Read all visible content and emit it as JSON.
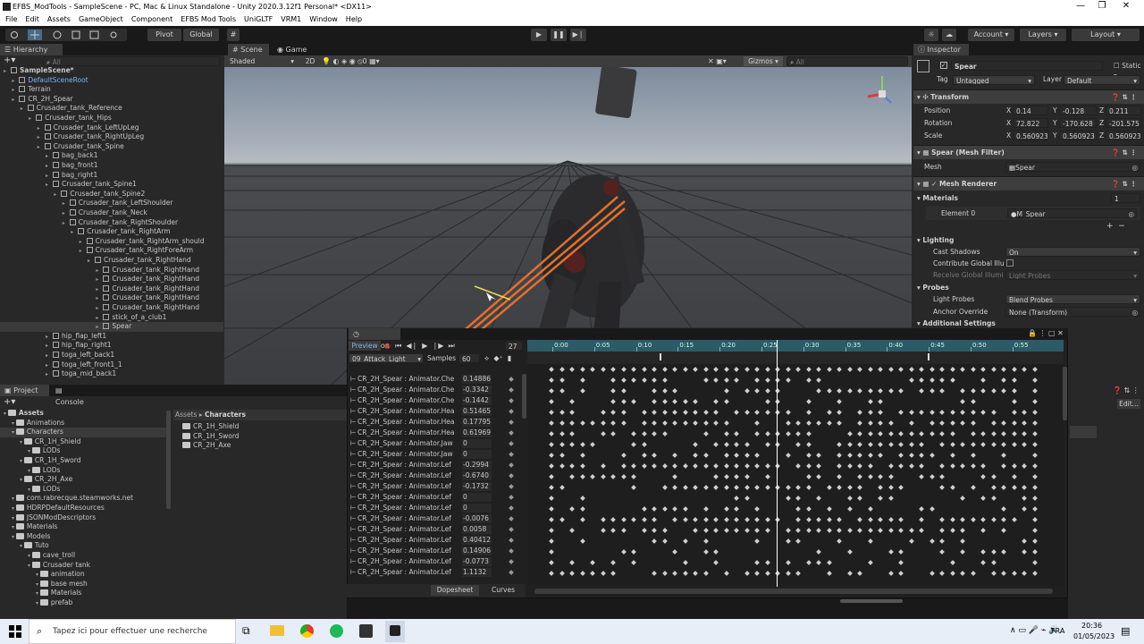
{
  "titlebar": {
    "title": "EFBS_ModTools - SampleScene - PC, Mac & Linux Standalone - Unity 2020.3.12f1 Personal* <DX11>",
    "minimize": "—",
    "maximize": "❐",
    "close": "✕"
  },
  "menu": [
    "File",
    "Edit",
    "Assets",
    "GameObject",
    "Component",
    "EFBS Mod Tools",
    "UniGLTF",
    "VRM1",
    "Window",
    "Help"
  ],
  "toolbar": {
    "pivot": "Pivot",
    "global": "Global",
    "account": "Account",
    "layers": "Layers",
    "layout": "Layout"
  },
  "hierarchy": {
    "tab": "Hierarchy",
    "search_placeholder": "All",
    "items": [
      {
        "label": "SampleScene*",
        "depth": 0
      },
      {
        "label": "DefaultSceneRoot",
        "depth": 1
      },
      {
        "label": "Terrain",
        "depth": 1
      },
      {
        "label": "CR_2H_Spear",
        "depth": 1
      },
      {
        "label": "Crusader_tank_Reference",
        "depth": 2
      },
      {
        "label": "Crusader_tank_Hips",
        "depth": 3
      },
      {
        "label": "Crusader_tank_LeftUpLeg",
        "depth": 4
      },
      {
        "label": "Crusader_tank_RightUpLeg",
        "depth": 4
      },
      {
        "label": "Crusader_tank_Spine",
        "depth": 4
      },
      {
        "label": "bag_back1",
        "depth": 5
      },
      {
        "label": "bag_front1",
        "depth": 5
      },
      {
        "label": "bag_right1",
        "depth": 5
      },
      {
        "label": "Crusader_tank_Spine1",
        "depth": 5
      },
      {
        "label": "Crusader_tank_Spine2",
        "depth": 6
      },
      {
        "label": "Crusader_tank_LeftShoulder",
        "depth": 7
      },
      {
        "label": "Crusader_tank_Neck",
        "depth": 7
      },
      {
        "label": "Crusader_tank_RightShoulder",
        "depth": 7
      },
      {
        "label": "Crusader_tank_RightArm",
        "depth": 8
      },
      {
        "label": "Crusader_tank_RightArm_should",
        "depth": 9
      },
      {
        "label": "Crusader_tank_RightForeArm",
        "depth": 9
      },
      {
        "label": "Crusader_tank_RightHand",
        "depth": 10
      },
      {
        "label": "Crusader_tank_RightHand",
        "depth": 11
      },
      {
        "label": "Crusader_tank_RightHand",
        "depth": 11
      },
      {
        "label": "Crusader_tank_RightHand",
        "depth": 11
      },
      {
        "label": "Crusader_tank_RightHand",
        "depth": 11
      },
      {
        "label": "Crusader_tank_RightHand",
        "depth": 11
      },
      {
        "label": "stick_of_a_club1",
        "depth": 11
      },
      {
        "label": "Spear",
        "depth": 11
      },
      {
        "label": "hip_flap_left1",
        "depth": 5
      },
      {
        "label": "hip_flap_right1",
        "depth": 5
      },
      {
        "label": "toga_left_back1",
        "depth": 5
      },
      {
        "label": "toga_left_front1_1",
        "depth": 5
      },
      {
        "label": "toga_mid_back1",
        "depth": 5
      }
    ]
  },
  "scene": {
    "tab_scene": "Scene",
    "tab_game": "Game",
    "shading": "Shaded",
    "mode_2d": "2D",
    "gizmos": "Gizmos",
    "search_placeholder": "All",
    "hidden_count": "0"
  },
  "inspector": {
    "tab": "Inspector",
    "object_name": "Spear",
    "static_label": "Static",
    "tag_label": "Tag",
    "tag_value": "Untagged",
    "layer_label": "Layer",
    "layer_value": "Default",
    "transform": {
      "title": "Transform",
      "position_label": "Position",
      "position": {
        "x": "0.14",
        "y": "-0.128",
        "z": "0.211"
      },
      "rotation_label": "Rotation",
      "rotation": {
        "x": "72.822",
        "y": "-170.628",
        "z": "-201.575"
      },
      "scale_label": "Scale",
      "scale": {
        "x": "0.560923",
        "y": "0.560923",
        "z": "0.560923"
      }
    },
    "mesh_filter": {
      "title": "Spear (Mesh Filter)",
      "mesh_label": "Mesh",
      "mesh_value": "Spear"
    },
    "mesh_renderer": {
      "title": "Mesh Renderer",
      "materials_label": "Materials",
      "materials_count": "1",
      "element0_label": "Element 0",
      "element0_value": "M_Spear",
      "lighting": "Lighting",
      "cast_shadows_label": "Cast Shadows",
      "cast_shadows_value": "On",
      "contribute_gi_label": "Contribute Global Illu",
      "receive_gi_label": "Receive Global Illumi",
      "receive_gi_value": "Light Probes",
      "probes": "Probes",
      "light_probes_label": "Light Probes",
      "light_probes_value": "Blend Probes",
      "anchor_label": "Anchor Override",
      "anchor_value": "None (Transform)",
      "additional": "Additional Settings"
    }
  },
  "project": {
    "tab_project": "Project",
    "tab_console": "Console",
    "tree": [
      {
        "label": "Assets",
        "depth": 0
      },
      {
        "label": "Animations",
        "depth": 1
      },
      {
        "label": "Characters",
        "depth": 1
      },
      {
        "label": "CR_1H_Shield",
        "depth": 2
      },
      {
        "label": "LODs",
        "depth": 3
      },
      {
        "label": "CR_1H_Sword",
        "depth": 2
      },
      {
        "label": "LODs",
        "depth": 3
      },
      {
        "label": "CR_2H_Axe",
        "depth": 2
      },
      {
        "label": "LODs",
        "depth": 3
      },
      {
        "label": "com.rabrecque.steamworks.net",
        "depth": 1
      },
      {
        "label": "HDRPDefaultResources",
        "depth": 1
      },
      {
        "label": "JSONModDescriptors",
        "depth": 1
      },
      {
        "label": "Materials",
        "depth": 1
      },
      {
        "label": "Models",
        "depth": 1
      },
      {
        "label": "Tuto",
        "depth": 2
      },
      {
        "label": "cave_troll",
        "depth": 3
      },
      {
        "label": "Crusader tank",
        "depth": 3
      },
      {
        "label": "animation",
        "depth": 4
      },
      {
        "label": "base mesh",
        "depth": 4
      },
      {
        "label": "Materials",
        "depth": 4
      },
      {
        "label": "prefab",
        "depth": 4
      }
    ],
    "breadcrumb_root": "Assets",
    "breadcrumb_sep": "▸",
    "breadcrumb_current": "Characters",
    "files": [
      "CR_1H_Shield",
      "CR_1H_Sword",
      "CR_2H_Axe"
    ]
  },
  "animation": {
    "tab": "Animation",
    "preview": "Preview",
    "frame": "27",
    "clip": "09_Attack_Light",
    "samples_label": "Samples",
    "samples_value": "60",
    "time_labels": [
      "0:00",
      "0:05",
      "0:10",
      "0:15",
      "0:20",
      "0:25",
      "0:30",
      "0:35",
      "0:40",
      "0:45",
      "0:50",
      "0:55"
    ],
    "properties": [
      {
        "name": "CR_2H_Spear : Animator.Che",
        "value": "0.14886"
      },
      {
        "name": "CR_2H_Spear : Animator.Che",
        "value": "-0.3342"
      },
      {
        "name": "CR_2H_Spear : Animator.Che",
        "value": "-0.1442"
      },
      {
        "name": "CR_2H_Spear : Animator.Hea",
        "value": "0.51465"
      },
      {
        "name": "CR_2H_Spear : Animator.Hea",
        "value": "0.17795"
      },
      {
        "name": "CR_2H_Spear : Animator.Hea",
        "value": "0.61969"
      },
      {
        "name": "CR_2H_Spear : Animator.Jaw",
        "value": "0"
      },
      {
        "name": "CR_2H_Spear : Animator.Jaw",
        "value": "0"
      },
      {
        "name": "CR_2H_Spear : Animator.Lef",
        "value": "-0.2994"
      },
      {
        "name": "CR_2H_Spear : Animator.Lef",
        "value": "-0.6740"
      },
      {
        "name": "CR_2H_Spear : Animator.Lef",
        "value": "-0.1732"
      },
      {
        "name": "CR_2H_Spear : Animator.Lef",
        "value": "0"
      },
      {
        "name": "CR_2H_Spear : Animator.Lef",
        "value": "0"
      },
      {
        "name": "CR_2H_Spear : Animator.Lef",
        "value": "-0.0076"
      },
      {
        "name": "CR_2H_Spear : Animator.Lef",
        "value": "0.0058"
      },
      {
        "name": "CR_2H_Spear : Animator.Lef",
        "value": "0.40412"
      },
      {
        "name": "CR_2H_Spear : Animator.Lef",
        "value": "0.14906"
      },
      {
        "name": "CR_2H_Spear : Animator.Lef",
        "value": "-0.0773"
      },
      {
        "name": "CR_2H_Spear : Animator.Lef",
        "value": "1.1132"
      }
    ],
    "dopesheet": "Dopesheet",
    "curves": "Curves"
  },
  "taskbar": {
    "search_placeholder": "Tapez ici pour effectuer une recherche",
    "lang": "FRA",
    "time": "20:36",
    "date": "01/05/2023"
  }
}
